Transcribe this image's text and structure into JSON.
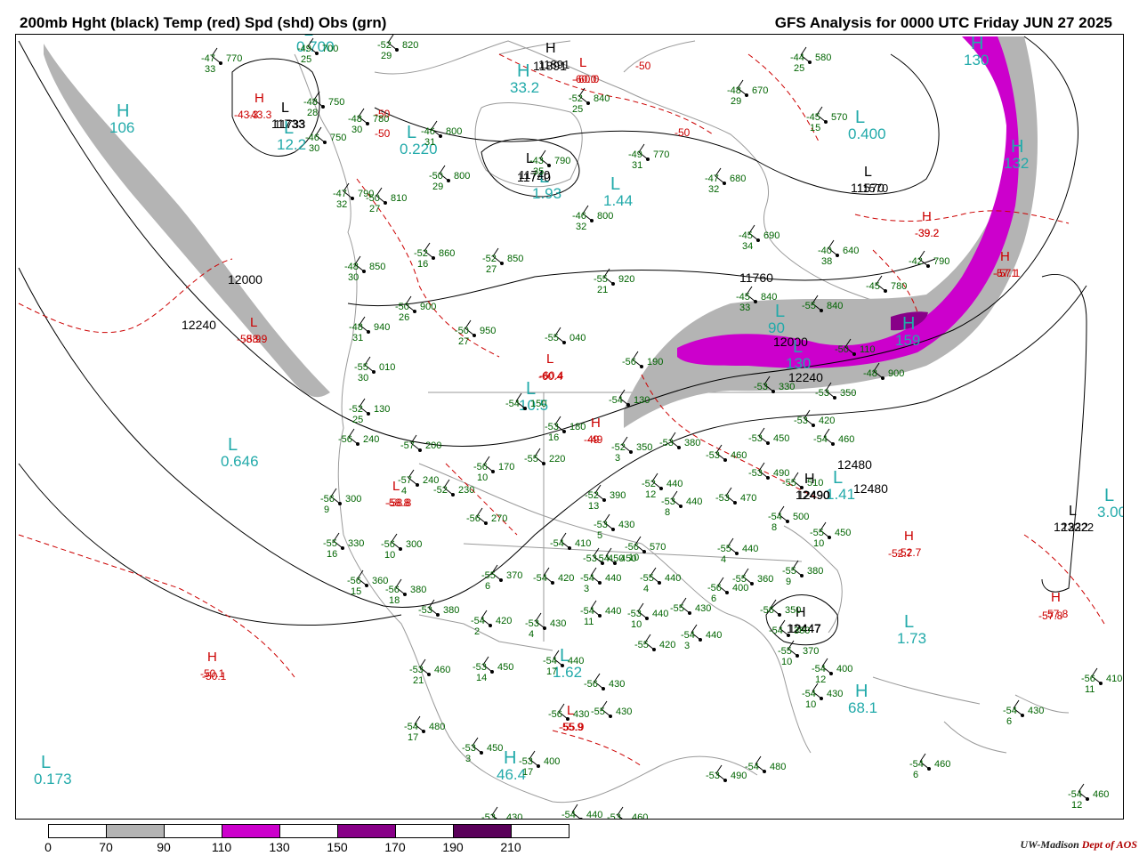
{
  "header": {
    "title_left": "200mb Hght (black) Temp (red) Spd (shd) Obs (grn)",
    "title_right": "GFS Analysis for 0000 UTC Friday  JUN 27 2025"
  },
  "colors": {
    "height": "#000000",
    "temperature": "#cc0000",
    "obs": "#006400",
    "pressure_center": "#22aaaa",
    "speed_70_90": "#b4b4b4",
    "speed_110_130": "#cc00cc",
    "speed_130_150": "#b000b0",
    "speed_150_170": "#880088",
    "speed_190_210": "#5a005a",
    "land": "#9a9a9a"
  },
  "legend": {
    "bins": [
      {
        "color": "#ffffff"
      },
      {
        "color": "#b4b4b4"
      },
      {
        "color": "#ffffff"
      },
      {
        "color": "#cc00cc"
      },
      {
        "color": "#ffffff"
      },
      {
        "color": "#880088"
      },
      {
        "color": "#ffffff"
      },
      {
        "color": "#5a005a"
      },
      {
        "color": "#ffffff"
      }
    ],
    "ticks": [
      "0",
      "70",
      "90",
      "110",
      "130",
      "150",
      "170",
      "190",
      "210"
    ]
  },
  "credit": {
    "org": "UW-Madison",
    "dept": "Dept of AOS"
  },
  "height_labels": [
    "12000",
    "12240",
    "11733",
    "11760",
    "11570",
    "12000",
    "12240",
    "12480",
    "12480",
    "12490",
    "12322",
    "12447",
    "11891",
    "11740"
  ],
  "temp_labels": [
    "-43.3",
    "-50",
    "-50",
    "-60.0",
    "-50",
    "-50",
    "-39.2",
    "-57.1",
    "-58.9",
    "-58.8",
    "-60.4",
    "-49",
    "-52.7",
    "-57.8",
    "-50.1",
    "-55.9"
  ],
  "centers": [
    {
      "letter": "H",
      "value": "106",
      "kind": "speed"
    },
    {
      "letter": "H",
      "value": "130",
      "kind": "speed"
    },
    {
      "letter": "H",
      "value": "132",
      "kind": "speed"
    },
    {
      "letter": "H",
      "value": "159",
      "kind": "speed"
    },
    {
      "letter": "L",
      "value": "0.400",
      "kind": "speed"
    },
    {
      "letter": "L",
      "value": "1.93",
      "kind": "speed"
    },
    {
      "letter": "L",
      "value": "1.44",
      "kind": "speed"
    },
    {
      "letter": "L",
      "value": "0.646",
      "kind": "speed"
    },
    {
      "letter": "L",
      "value": "10.5",
      "kind": "speed"
    },
    {
      "letter": "L",
      "value": "1.73",
      "kind": "speed"
    },
    {
      "letter": "L",
      "value": "1.41",
      "kind": "speed"
    },
    {
      "letter": "L",
      "value": "3.00",
      "kind": "speed"
    },
    {
      "letter": "H",
      "value": "68.1",
      "kind": "speed"
    },
    {
      "letter": "L",
      "value": "1.62",
      "kind": "speed"
    },
    {
      "letter": "H",
      "value": "46.4",
      "kind": "speed"
    },
    {
      "letter": "L",
      "value": "0.173",
      "kind": "speed"
    },
    {
      "letter": "H",
      "value": "33.2",
      "kind": "speed"
    },
    {
      "letter": "L",
      "value": "0.220",
      "kind": "speed"
    },
    {
      "letter": "L",
      "value": "12.2",
      "kind": "speed"
    },
    {
      "letter": "L",
      "value": "0.700",
      "kind": "speed"
    },
    {
      "letter": "L",
      "value": "90",
      "kind": "speed"
    },
    {
      "letter": "L",
      "value": "130",
      "kind": "speed"
    },
    {
      "letter": "L",
      "value": "11570",
      "kind": "height"
    },
    {
      "letter": "H",
      "value": "-52.7",
      "kind": "temp"
    },
    {
      "letter": "H",
      "value": "-50.1",
      "kind": "temp"
    },
    {
      "letter": "L",
      "value": "-58.8",
      "kind": "temp"
    },
    {
      "letter": "L",
      "value": "-58.9",
      "kind": "temp"
    },
    {
      "letter": "H",
      "value": "-43.3",
      "kind": "temp"
    },
    {
      "letter": "H",
      "value": "-39.2",
      "kind": "temp"
    },
    {
      "letter": "L",
      "value": "-60.4",
      "kind": "temp"
    },
    {
      "letter": "L",
      "value": "-60.0",
      "kind": "temp"
    },
    {
      "letter": "H",
      "value": "-57.8",
      "kind": "temp"
    },
    {
      "letter": "H",
      "value": "-49",
      "kind": "temp"
    },
    {
      "letter": "L",
      "value": "-55.9",
      "kind": "temp"
    },
    {
      "letter": "H",
      "value": "11891",
      "kind": "height"
    },
    {
      "letter": "L",
      "value": "11733",
      "kind": "height"
    },
    {
      "letter": "L",
      "value": "11740",
      "kind": "height"
    },
    {
      "letter": "L",
      "value": "12322",
      "kind": "height"
    },
    {
      "letter": "H",
      "value": "12490",
      "kind": "height"
    },
    {
      "letter": "H",
      "value": "12447",
      "kind": "height"
    },
    {
      "letter": "H",
      "value": "-57.1",
      "kind": "temp"
    }
  ],
  "observations": [
    {
      "t": "-47",
      "d": "33",
      "h": "770"
    },
    {
      "t": "-49",
      "d": "25",
      "h": "700"
    },
    {
      "t": "-52",
      "d": "29",
      "h": "820"
    },
    {
      "t": "-48",
      "d": "28",
      "h": "750"
    },
    {
      "t": "-48",
      "d": "30",
      "h": "780"
    },
    {
      "t": "-46",
      "d": "30",
      "h": "750"
    },
    {
      "t": "-46",
      "d": "31",
      "h": "800"
    },
    {
      "t": "-43",
      "d": "35",
      "h": "790"
    },
    {
      "t": "-52",
      "d": "25",
      "h": "840"
    },
    {
      "t": "-48",
      "d": "29",
      "h": "670"
    },
    {
      "t": "-44",
      "d": "25",
      "h": "580"
    },
    {
      "t": "-45",
      "d": "15",
      "h": "570"
    },
    {
      "t": "-49",
      "d": "31",
      "h": "770"
    },
    {
      "t": "-47",
      "d": "32",
      "h": "680"
    },
    {
      "t": "-50",
      "d": "29",
      "h": "800"
    },
    {
      "t": "-47",
      "d": "32",
      "h": "790"
    },
    {
      "t": "-50",
      "d": "27",
      "h": "810"
    },
    {
      "t": "-46",
      "d": "32",
      "h": "800"
    },
    {
      "t": "-45",
      "d": "34",
      "h": "690"
    },
    {
      "t": "-40",
      "d": "38",
      "h": "640"
    },
    {
      "t": "-42",
      "d": "",
      "h": "790"
    },
    {
      "t": "-52",
      "d": "16",
      "h": "860"
    },
    {
      "t": "-52",
      "d": "27",
      "h": "850"
    },
    {
      "t": "-48",
      "d": "30",
      "h": "850"
    },
    {
      "t": "-55",
      "d": "21",
      "h": "920"
    },
    {
      "t": "-45",
      "d": "33",
      "h": "840"
    },
    {
      "t": "-45",
      "d": "",
      "h": "780"
    },
    {
      "t": "-50",
      "d": "26",
      "h": "900"
    },
    {
      "t": "-50",
      "d": "27",
      "h": "950"
    },
    {
      "t": "-48",
      "d": "31",
      "h": "940"
    },
    {
      "t": "-55",
      "d": "",
      "h": "040"
    },
    {
      "t": "-55",
      "d": "30",
      "h": "010"
    },
    {
      "t": "-56",
      "d": "",
      "h": "190"
    },
    {
      "t": "-52",
      "d": "25",
      "h": "130"
    },
    {
      "t": "-54",
      "d": "",
      "h": "150"
    },
    {
      "t": "-54",
      "d": "",
      "h": "130"
    },
    {
      "t": "-53",
      "d": "",
      "h": "330"
    },
    {
      "t": "-53",
      "d": "",
      "h": "350"
    },
    {
      "t": "-50",
      "d": "",
      "h": "110"
    },
    {
      "t": "-48",
      "d": "",
      "h": "900"
    },
    {
      "t": "-55",
      "d": "",
      "h": "840"
    },
    {
      "t": "-56",
      "d": "",
      "h": "240"
    },
    {
      "t": "-57",
      "d": "",
      "h": "200"
    },
    {
      "t": "-53",
      "d": "16",
      "h": "180"
    },
    {
      "t": "-53",
      "d": "",
      "h": "420"
    },
    {
      "t": "-53",
      "d": "",
      "h": "450"
    },
    {
      "t": "-54",
      "d": "",
      "h": "460"
    },
    {
      "t": "-52",
      "d": "3",
      "h": "350"
    },
    {
      "t": "-53",
      "d": "",
      "h": "380"
    },
    {
      "t": "-53",
      "d": "",
      "h": "460"
    },
    {
      "t": "-53",
      "d": "",
      "h": "490"
    },
    {
      "t": "-57",
      "d": "4",
      "h": "240"
    },
    {
      "t": "-56",
      "d": "10",
      "h": "170"
    },
    {
      "t": "-55",
      "d": "",
      "h": "220"
    },
    {
      "t": "-52",
      "d": "",
      "h": "230"
    },
    {
      "t": "-52",
      "d": "13",
      "h": "390"
    },
    {
      "t": "-52",
      "d": "12",
      "h": "440"
    },
    {
      "t": "-53",
      "d": "8",
      "h": "440"
    },
    {
      "t": "-53",
      "d": "",
      "h": "470"
    },
    {
      "t": "-55",
      "d": "",
      "h": "510"
    },
    {
      "t": "-56",
      "d": "9",
      "h": "300"
    },
    {
      "t": "-56",
      "d": "",
      "h": "270"
    },
    {
      "t": "-53",
      "d": "5",
      "h": "430"
    },
    {
      "t": "-54",
      "d": "",
      "h": "450"
    },
    {
      "t": "-54",
      "d": "8",
      "h": "500"
    },
    {
      "t": "-55",
      "d": "10",
      "h": "450"
    },
    {
      "t": "-55",
      "d": "16",
      "h": "330"
    },
    {
      "t": "-56",
      "d": "10",
      "h": "300"
    },
    {
      "t": "-54",
      "d": "",
      "h": "410"
    },
    {
      "t": "-53",
      "d": "",
      "h": "450"
    },
    {
      "t": "-56",
      "d": "10",
      "h": "570"
    },
    {
      "t": "-55",
      "d": "4",
      "h": "440"
    },
    {
      "t": "-55",
      "d": "9",
      "h": "380"
    },
    {
      "t": "-56",
      "d": "15",
      "h": "360"
    },
    {
      "t": "-56",
      "d": "18",
      "h": "380"
    },
    {
      "t": "-55",
      "d": "6",
      "h": "370"
    },
    {
      "t": "-54",
      "d": "",
      "h": "420"
    },
    {
      "t": "-54",
      "d": "3",
      "h": "440"
    },
    {
      "t": "-55",
      "d": "4",
      "h": "440"
    },
    {
      "t": "-56",
      "d": "6",
      "h": "400"
    },
    {
      "t": "-55",
      "d": "",
      "h": "360"
    },
    {
      "t": "-53",
      "d": "",
      "h": "380"
    },
    {
      "t": "-54",
      "d": "2",
      "h": "420"
    },
    {
      "t": "-53",
      "d": "4",
      "h": "430"
    },
    {
      "t": "-54",
      "d": "11",
      "h": "440"
    },
    {
      "t": "-53",
      "d": "10",
      "h": "440"
    },
    {
      "t": "-55",
      "d": "",
      "h": "430"
    },
    {
      "t": "-56",
      "d": "",
      "h": "350"
    },
    {
      "t": "-54",
      "d": "",
      "h": "360"
    },
    {
      "t": "-55",
      "d": "",
      "h": "420"
    },
    {
      "t": "-54",
      "d": "3",
      "h": "440"
    },
    {
      "t": "-55",
      "d": "10",
      "h": "370"
    },
    {
      "t": "-53",
      "d": "21",
      "h": "460"
    },
    {
      "t": "-53",
      "d": "14",
      "h": "450"
    },
    {
      "t": "-54",
      "d": "17",
      "h": "440"
    },
    {
      "t": "-56",
      "d": "",
      "h": "430"
    },
    {
      "t": "-55",
      "d": "",
      "h": "430"
    },
    {
      "t": "-56",
      "d": "",
      "h": "430"
    },
    {
      "t": "-54",
      "d": "12",
      "h": "400"
    },
    {
      "t": "-54",
      "d": "10",
      "h": "430"
    },
    {
      "t": "-56",
      "d": "11",
      "h": "410"
    },
    {
      "t": "-54",
      "d": "6",
      "h": "430"
    },
    {
      "t": "-54",
      "d": "17",
      "h": "480"
    },
    {
      "t": "-53",
      "d": "3",
      "h": "450"
    },
    {
      "t": "-53",
      "d": "17",
      "h": "400"
    },
    {
      "t": "-54",
      "d": "",
      "h": "480"
    },
    {
      "t": "-53",
      "d": "",
      "h": "490"
    },
    {
      "t": "-54",
      "d": "6",
      "h": "460"
    },
    {
      "t": "-54",
      "d": "12",
      "h": "460"
    },
    {
      "t": "-53",
      "d": "",
      "h": "430"
    },
    {
      "t": "-54",
      "d": "",
      "h": "440"
    },
    {
      "t": "-53",
      "d": "",
      "h": "460"
    }
  ]
}
